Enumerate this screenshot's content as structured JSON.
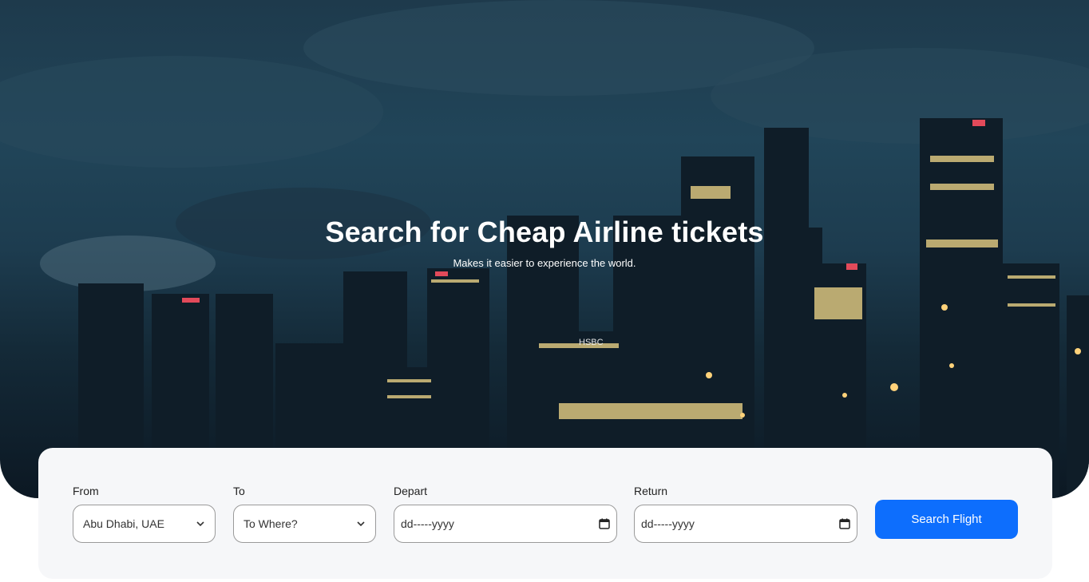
{
  "hero": {
    "title": "Search for Cheap Airline tickets",
    "subtitle": "Makes it easier to experience the world.",
    "building_signs": [
      "HSBC"
    ]
  },
  "search": {
    "from": {
      "label": "From",
      "value": "Abu Dhabi, UAE"
    },
    "to": {
      "label": "To",
      "value": "To Where?"
    },
    "depart": {
      "label": "Depart",
      "placeholder": "dd-----yyyy"
    },
    "return": {
      "label": "Return",
      "placeholder": "dd-----yyyy"
    },
    "button_label": "Search Flight"
  },
  "colors": {
    "accent": "#0d6efd",
    "panel_bg": "#f6f7f9"
  }
}
